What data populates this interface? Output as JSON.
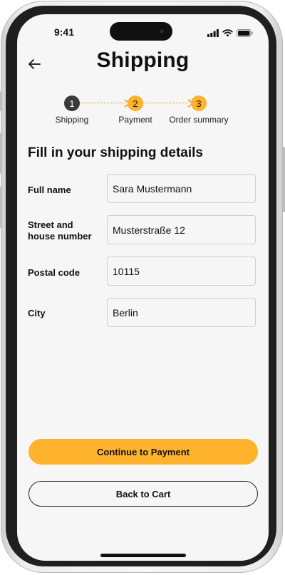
{
  "status_bar": {
    "time": "9:41",
    "icons": [
      "signal-icon",
      "wifi-icon",
      "battery-icon"
    ]
  },
  "header": {
    "back_icon": "arrow-left-icon",
    "title": "Shipping"
  },
  "stepper": {
    "steps": [
      {
        "number": "1",
        "label": "Shipping",
        "state": "completed"
      },
      {
        "number": "2",
        "label": "Payment",
        "state": "upcoming"
      },
      {
        "number": "3",
        "label": "Order summary",
        "state": "upcoming"
      }
    ]
  },
  "form": {
    "heading": "Fill in your shipping details",
    "fields": [
      {
        "label": "Full name",
        "value": "Sara Mustermann"
      },
      {
        "label": "Street and house number",
        "value": "Musterstraße 12"
      },
      {
        "label": "Postal code",
        "value": "10115"
      },
      {
        "label": "City",
        "value": "Berlin"
      }
    ]
  },
  "actions": {
    "continue_label": "Continue to Payment",
    "back_label": "Back to Cart"
  },
  "colors": {
    "accent": "#ffb22c",
    "completed_step": "#3a3a3a",
    "screen_background": "#f6f6f6"
  }
}
